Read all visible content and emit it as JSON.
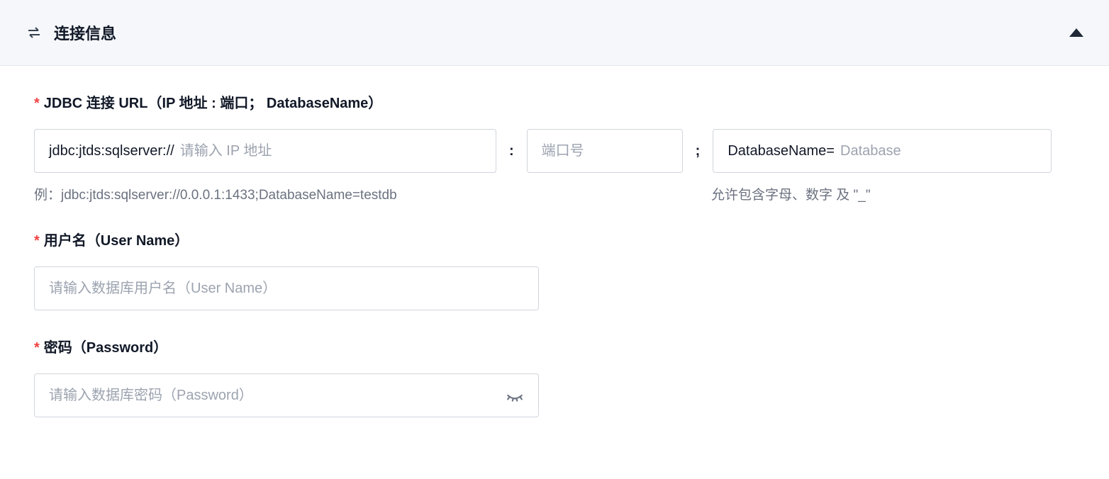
{
  "panel": {
    "title": "连接信息"
  },
  "jdbc": {
    "label": "JDBC 连接 URL（IP 地址 : 端口； DatabaseName）",
    "ip_prefix": "jdbc:jtds:sqlserver://",
    "ip_placeholder": "请输入 IP 地址",
    "port_placeholder": "端口号",
    "db_prefix": "DatabaseName=",
    "db_placeholder": "Database",
    "separator_colon": ":",
    "separator_semicolon": ";",
    "example": "例：jdbc:jtds:sqlserver://0.0.0.1:1433;DatabaseName=testdb",
    "db_hint": "允许包含字母、数字 及 \"_\""
  },
  "username": {
    "label": "用户名（User Name）",
    "placeholder": "请输入数据库用户名（User Name）"
  },
  "password": {
    "label": "密码（Password）",
    "placeholder": "请输入数据库密码（Password）"
  }
}
